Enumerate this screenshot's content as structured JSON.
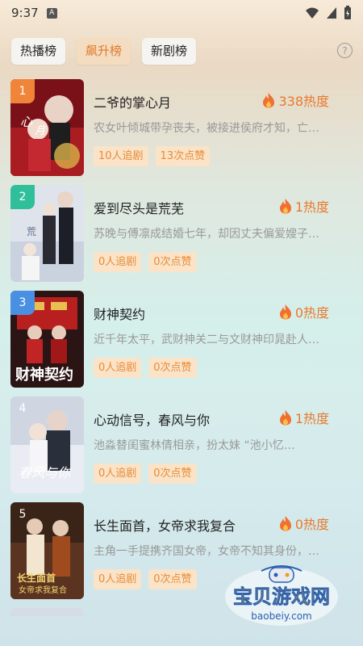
{
  "status_bar": {
    "time": "9:37",
    "notif_icon": "A"
  },
  "tabs": [
    {
      "label": "热播榜"
    },
    {
      "label": "飙升榜"
    },
    {
      "label": "新剧榜"
    }
  ],
  "help_icon_label": "?",
  "items": [
    {
      "rank": "1",
      "title": "二爷的掌心月",
      "heat": "338热度",
      "desc": "农女叶倾城带孕丧夫，被接进侯府才知，亡…",
      "follows": "10人追剧",
      "likes": "13次点赞",
      "rank_color": "#f0853a"
    },
    {
      "rank": "2",
      "title": "爱到尽头是荒芜",
      "heat": "1热度",
      "desc": "苏晚与傅凛成结婚七年，却因丈夫偏爱嫂子…",
      "follows": "0人追剧",
      "likes": "0次点赞",
      "rank_color": "#2fbf9a"
    },
    {
      "rank": "3",
      "title": "财神契约",
      "heat": "0热度",
      "desc": "近千年太平，武财神关二与文财神印晁赴人…",
      "follows": "0人追剧",
      "likes": "0次点赞",
      "rank_color": "#4a90e2"
    },
    {
      "rank": "4",
      "title": "心动信号，春风与你",
      "heat": "1热度",
      "desc": "池淼替闺蜜林倩相亲，扮太妹 “池小忆…",
      "follows": "0人追剧",
      "likes": "0次点赞",
      "rank_color": ""
    },
    {
      "rank": "5",
      "title": "长生面首，女帝求我复合",
      "heat": "0热度",
      "desc": "主角一手提携齐国女帝，女帝不知其身份，…",
      "follows": "0人追剧",
      "likes": "0次点赞",
      "rank_color": ""
    }
  ],
  "watermark": {
    "text": "宝贝游戏网",
    "url": "baobeiy.com"
  }
}
